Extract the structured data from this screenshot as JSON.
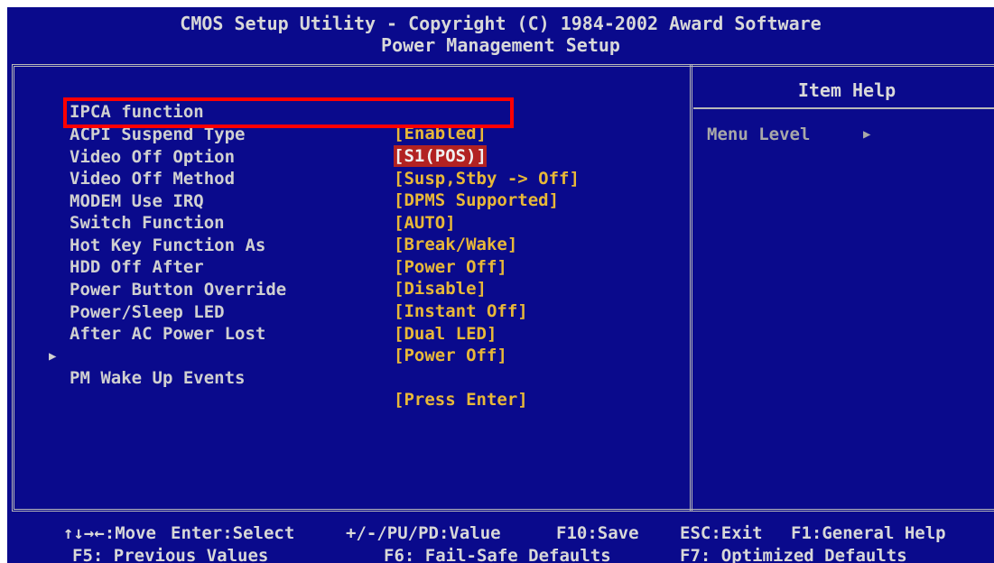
{
  "header": {
    "title": "CMOS Setup Utility - Copyright (C) 1984-2002 Award Software",
    "subtitle": "Power Management Setup"
  },
  "settings": [
    {
      "label": "IPCA function",
      "value": "[Enabled]"
    },
    {
      "label": "ACPI Suspend Type",
      "value": "[S1(POS)]"
    },
    {
      "label": "Video Off Option",
      "value": "[Susp,Stby -> Off]"
    },
    {
      "label": "Video Off Method",
      "value": "[DPMS Supported]"
    },
    {
      "label": "MODEM Use IRQ",
      "value": "[AUTO]"
    },
    {
      "label": "Switch Function",
      "value": "[Break/Wake]"
    },
    {
      "label": "Hot Key Function As",
      "value": "[Power Off]"
    },
    {
      "label": "HDD Off After",
      "value": "[Disable]"
    },
    {
      "label": "Power Button Override",
      "value": "[Instant Off]"
    },
    {
      "label": "Power/Sleep LED",
      "value": "[Dual LED]"
    },
    {
      "label": "After AC Power Lost",
      "value": "[Power Off]"
    },
    {
      "label": "PM Wake Up Events",
      "value": "[Press Enter]"
    }
  ],
  "help": {
    "title": "Item Help",
    "menu_level": "Menu Level"
  },
  "footer": {
    "line1": {
      "move": "↑↓→←:Move",
      "select": "Enter:Select",
      "value": "+/-/PU/PD:Value",
      "save": "F10:Save",
      "exit": "ESC:Exit",
      "help": "F1:General Help"
    },
    "line2": {
      "previous": "F5: Previous Values",
      "failsafe": "F6: Fail-Safe Defaults",
      "optimized": "F7: Optimized Defaults"
    }
  },
  "colors": {
    "background": "#0a0a8c",
    "value_text": "#e8b838",
    "label_text": "#d0d0d0",
    "highlight_box": "#ff0000"
  }
}
